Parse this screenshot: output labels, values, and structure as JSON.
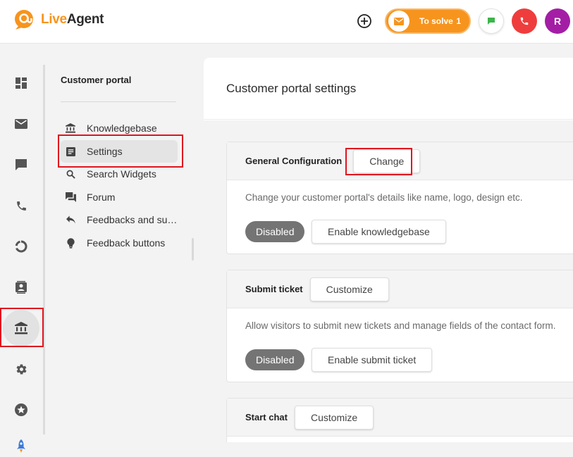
{
  "header": {
    "logo": {
      "live": "Live",
      "agent": "Agent"
    },
    "to_solve": {
      "label": "To solve",
      "count": "1"
    },
    "avatar_initial": "R"
  },
  "colors": {
    "brand_orange": "#f7941d",
    "phone_red": "#ef3d3d",
    "avatar_purple": "#a31ea5",
    "highlight_red": "#e0141e",
    "chat_green": "#3cb54a"
  },
  "rail": {
    "items": [
      "dashboard-icon",
      "mail-icon",
      "chat-icon",
      "phone-icon",
      "reports-icon",
      "contacts-icon",
      "knowledgebase-icon",
      "settings-icon",
      "star-icon",
      "rocket-icon"
    ],
    "active": "knowledgebase-icon"
  },
  "sidepanel": {
    "title": "Customer portal",
    "items": [
      {
        "label": "Knowledgebase",
        "icon": "bank-icon"
      },
      {
        "label": "Settings",
        "icon": "settings-list-icon"
      },
      {
        "label": "Search Widgets",
        "icon": "search-icon"
      },
      {
        "label": "Forum",
        "icon": "forum-icon"
      },
      {
        "label": "Feedbacks and suggestions",
        "icon": "reply-icon"
      },
      {
        "label": "Feedback buttons",
        "icon": "bulb-icon"
      }
    ],
    "active_index": 1
  },
  "main": {
    "title": "Customer portal settings",
    "sections": [
      {
        "title": "General Configuration",
        "action": "Change",
        "description": "Change your customer portal's details like name, logo, design etc.",
        "status": "Disabled",
        "enable_label": "Enable knowledgebase"
      },
      {
        "title": "Submit ticket",
        "action": "Customize",
        "description": "Allow visitors to submit new tickets and manage fields of the contact form.",
        "status": "Disabled",
        "enable_label": "Enable submit ticket"
      },
      {
        "title": "Start chat",
        "action": "Customize"
      }
    ]
  }
}
